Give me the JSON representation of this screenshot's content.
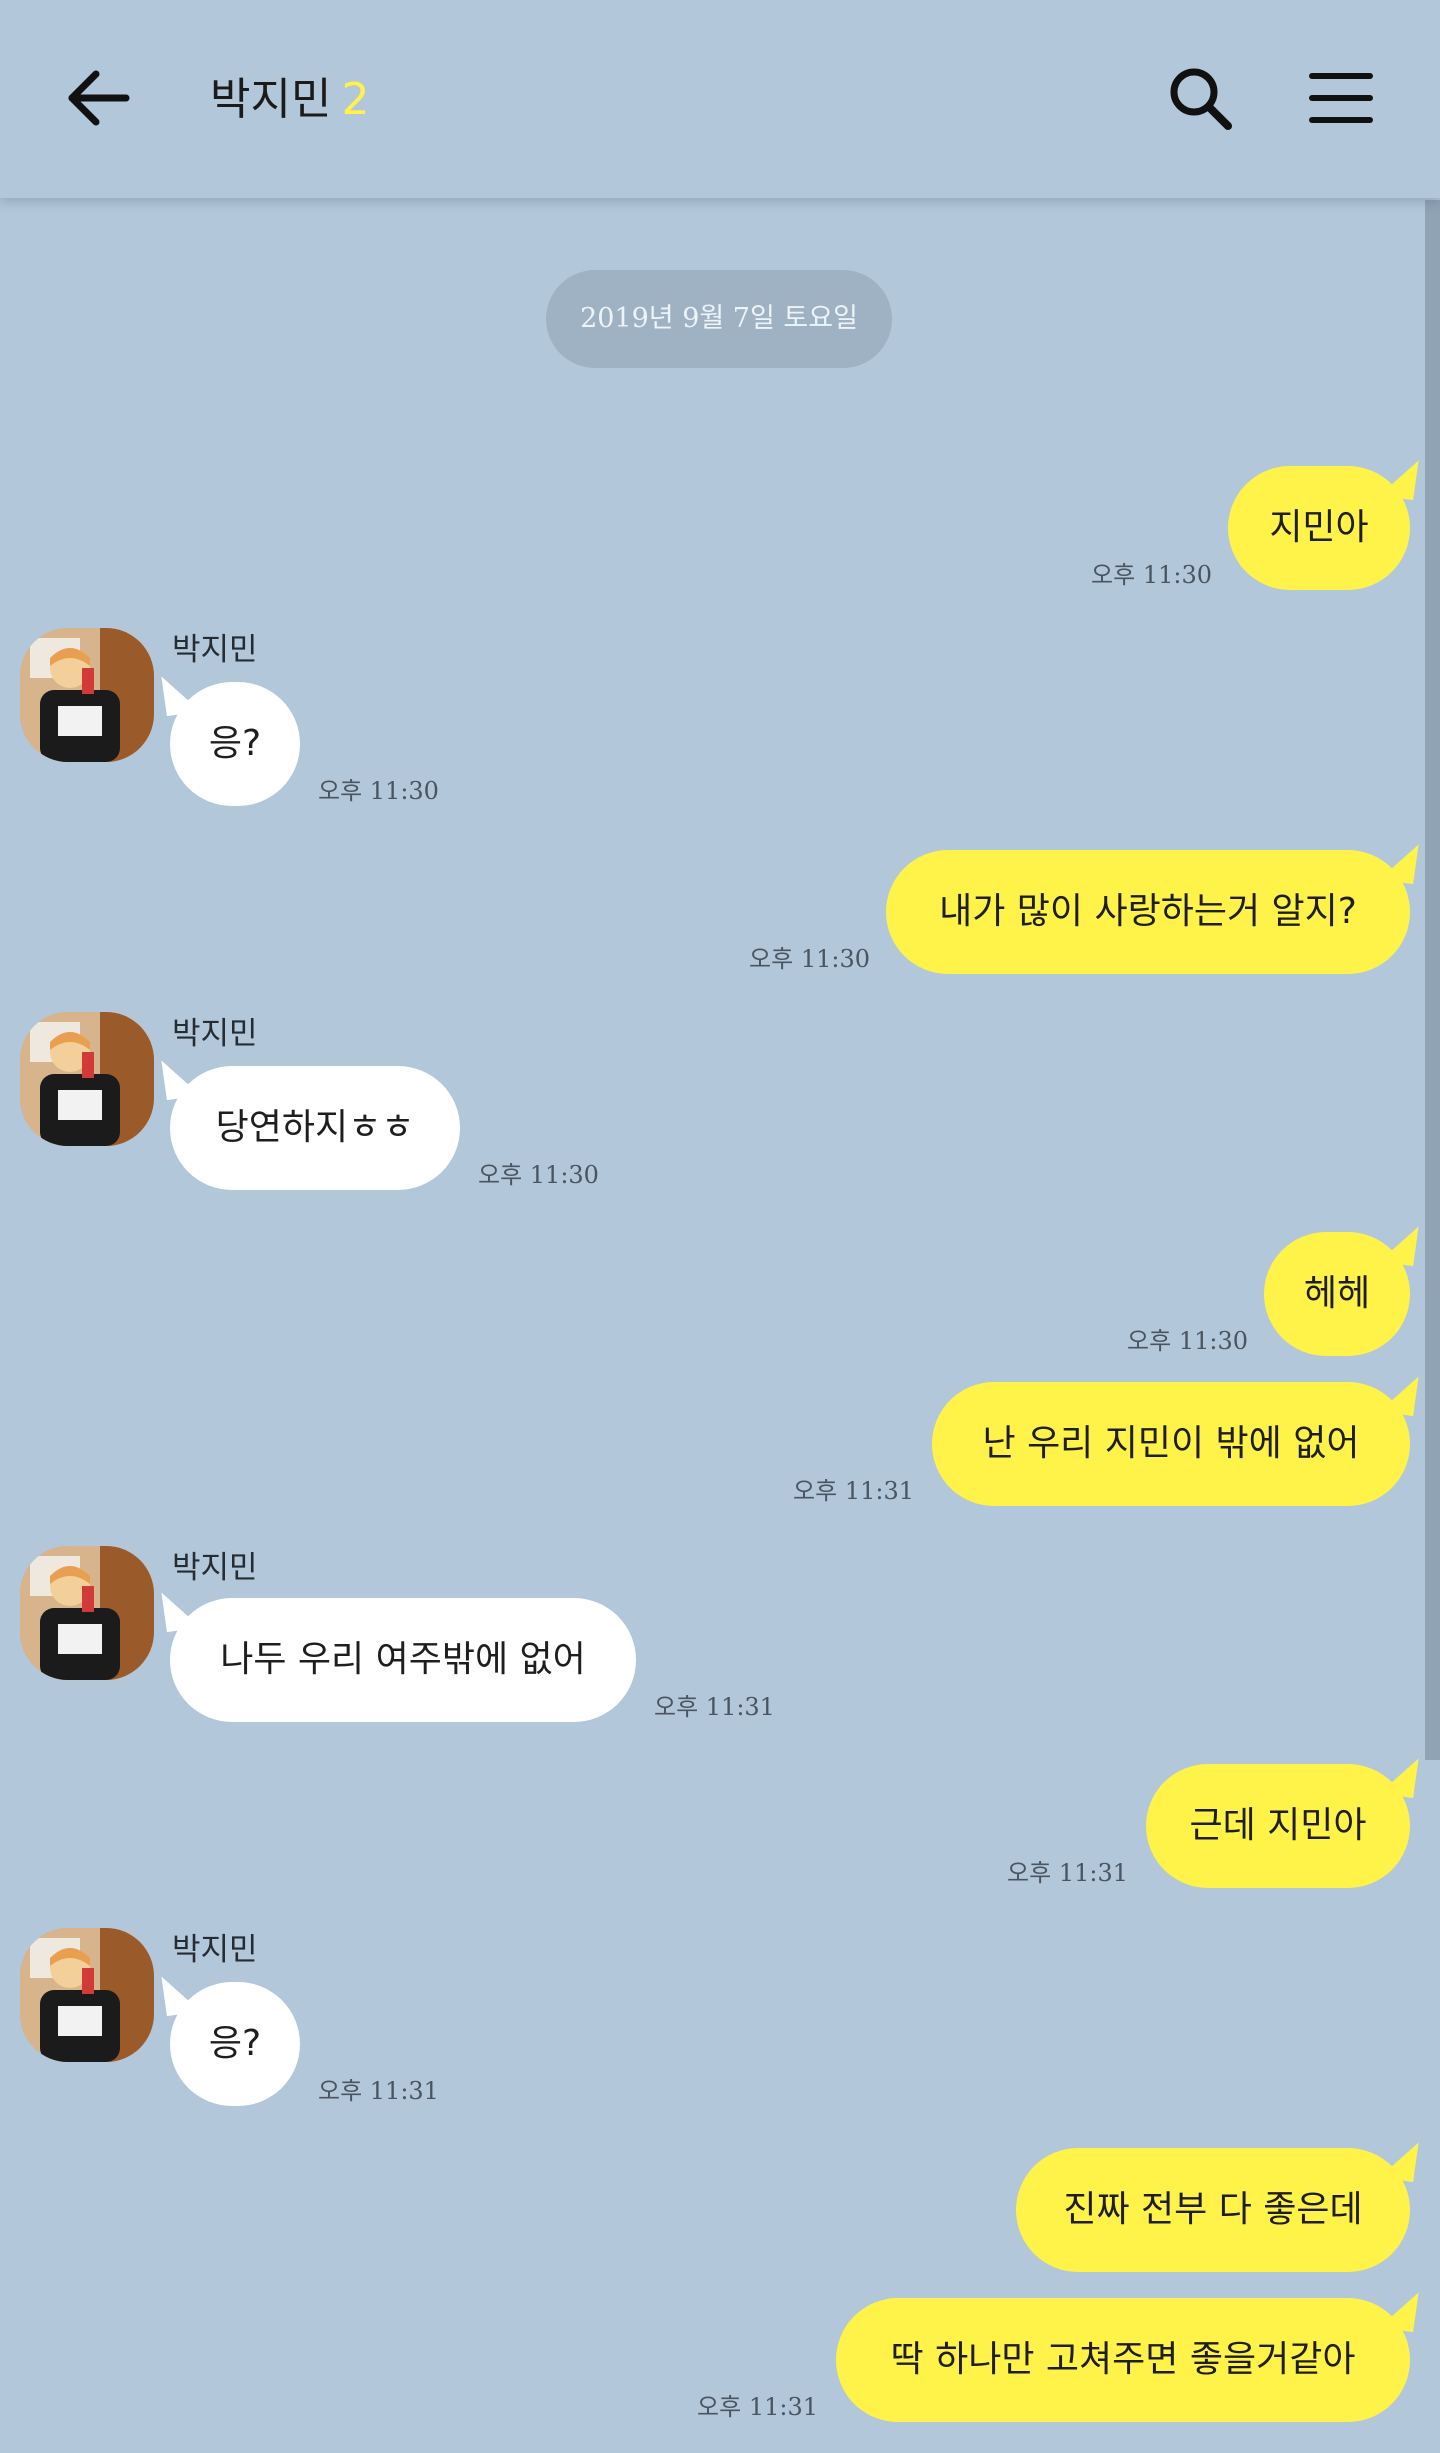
{
  "header": {
    "title": "박지민",
    "count": "2"
  },
  "date_divider": "2019년 9월 7일 토요일",
  "messages": [
    {
      "from": "me",
      "text": "지민아",
      "time": "오후 11:30"
    },
    {
      "from": "them",
      "sender": "박지민",
      "text": "응?",
      "time": "오후 11:30"
    },
    {
      "from": "me",
      "text": "내가 많이 사랑하는거 알지?",
      "time": "오후 11:30"
    },
    {
      "from": "them",
      "sender": "박지민",
      "text": "당연하지ㅎㅎ",
      "time": "오후 11:30"
    },
    {
      "from": "me",
      "text": "헤헤",
      "time": "오후 11:30"
    },
    {
      "from": "me",
      "text": "난 우리 지민이 밖에 없어",
      "time": "오후 11:31"
    },
    {
      "from": "them",
      "sender": "박지민",
      "text": "나두 우리 여주밖에 없어",
      "time": "오후 11:31"
    },
    {
      "from": "me",
      "text": "근데 지민아",
      "time": "오후 11:31"
    },
    {
      "from": "them",
      "sender": "박지민",
      "text": "응?",
      "time": "오후 11:31"
    },
    {
      "from": "me",
      "text": "진짜 전부 다 좋은데",
      "time": ""
    },
    {
      "from": "me",
      "text": "딱 하나만 고쳐주면 좋을거같아",
      "time": "오후 11:31"
    }
  ],
  "colors": {
    "background": "#b2c7da",
    "my_bubble": "#fff34a",
    "their_bubble": "#ffffff",
    "count_badge": "#fff34a"
  }
}
